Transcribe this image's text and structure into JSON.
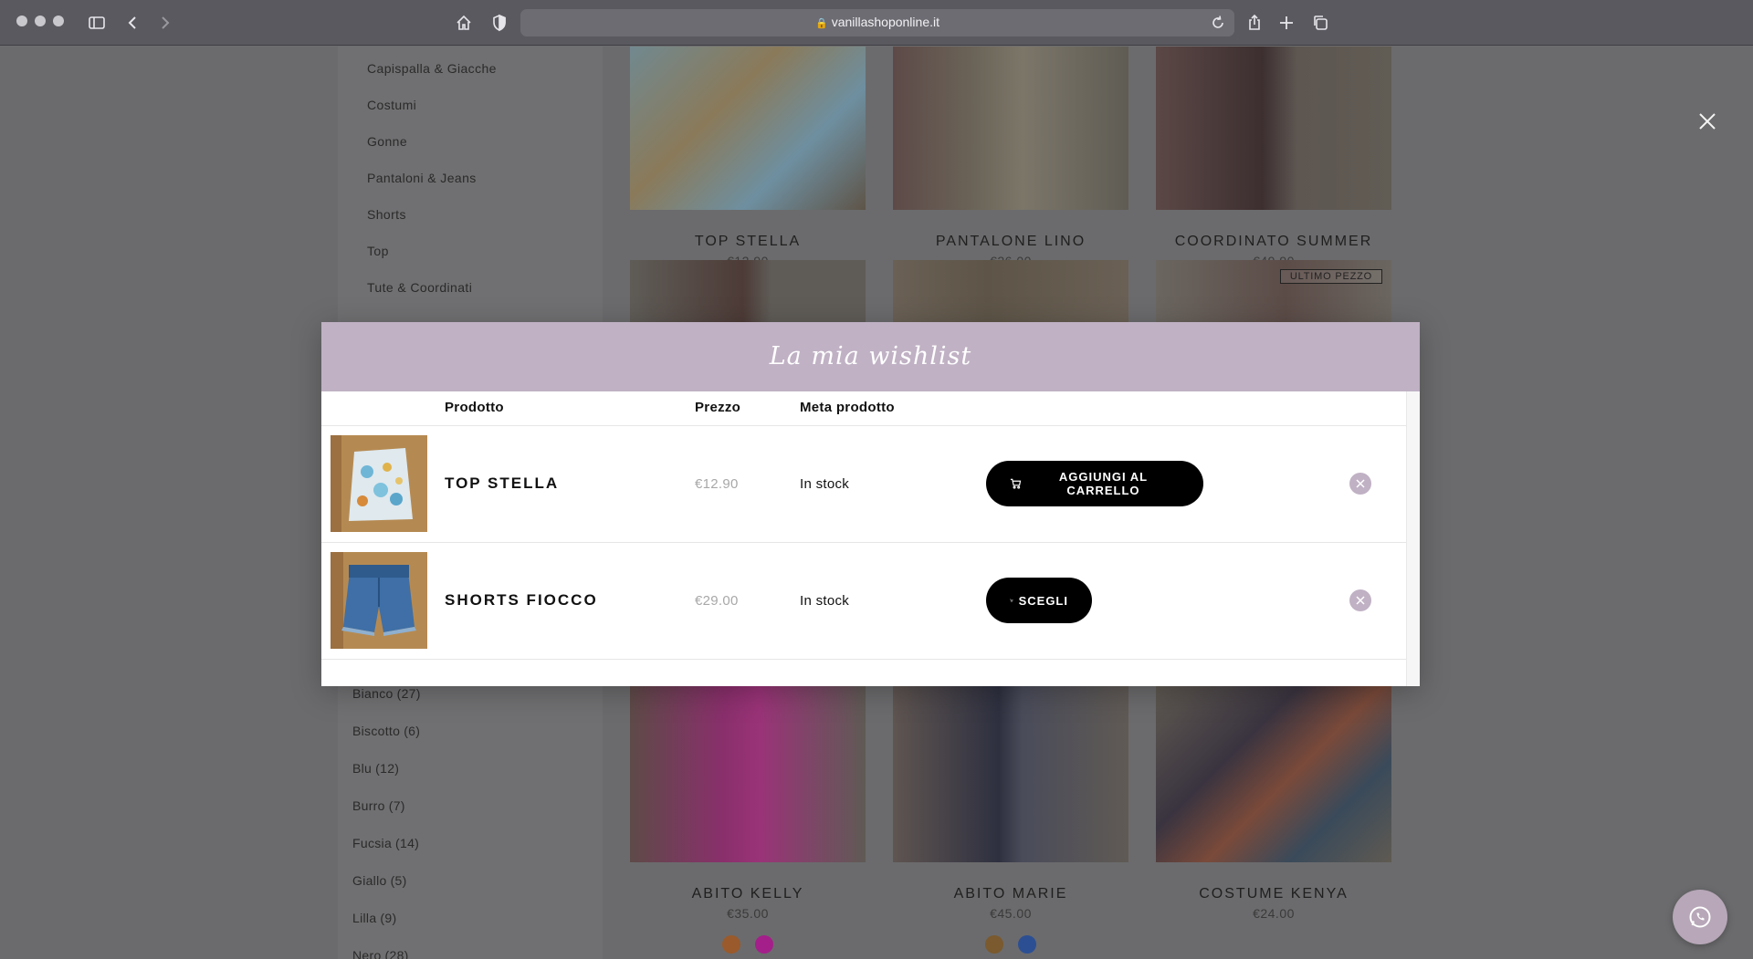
{
  "browser": {
    "url": "vanillashoponline.it"
  },
  "sidebar": {
    "categories": [
      "Capispalla & Giacche",
      "Costumi",
      "Gonne",
      "Pantaloni & Jeans",
      "Shorts",
      "Top",
      "Tute & Coordinati"
    ],
    "colors": [
      {
        "label": "Bianco",
        "count": "(27)"
      },
      {
        "label": "Biscotto",
        "count": "(6)"
      },
      {
        "label": "Blu",
        "count": "(12)"
      },
      {
        "label": "Burro",
        "count": "(7)"
      },
      {
        "label": "Fucsia",
        "count": "(14)"
      },
      {
        "label": "Giallo",
        "count": "(5)"
      },
      {
        "label": "Lilla",
        "count": "(9)"
      },
      {
        "label": "Nero",
        "count": "(28)"
      }
    ]
  },
  "products": {
    "row1": [
      {
        "name": "TOP STELLA",
        "price": "€12.90"
      },
      {
        "name": "PANTALONE LINO",
        "price": "€26.00"
      },
      {
        "name": "COORDINATO SUMMER",
        "price": "€49.90"
      }
    ],
    "row2_badge": "ULTIMO PEZZO",
    "row3": [
      {
        "name": "ABITO KELLY",
        "price": "€35.00",
        "swatches": [
          "#9a5a2b",
          "#a41f8a"
        ]
      },
      {
        "name": "ABITO MARIE",
        "price": "€45.00",
        "swatches": [
          "#7a5a2e",
          "#2c4f93"
        ]
      },
      {
        "name": "COSTUME KENYA",
        "price": "€24.00",
        "swatches": []
      }
    ]
  },
  "wishlist": {
    "title": "La mia wishlist",
    "columns": {
      "product": "Prodotto",
      "price": "Prezzo",
      "meta": "Meta prodotto"
    },
    "items": [
      {
        "name": "TOP STELLA",
        "price": "€12.90",
        "stock": "In stock",
        "action": "AGGIUNGI AL CARRELLO"
      },
      {
        "name": "SHORTS FIOCCO",
        "price": "€29.00",
        "stock": "In stock",
        "action": "SCEGLI"
      }
    ]
  },
  "colors": {
    "modal_header": "#c0b1c4",
    "button": "#000000",
    "overlay": "#6b6b6d"
  }
}
